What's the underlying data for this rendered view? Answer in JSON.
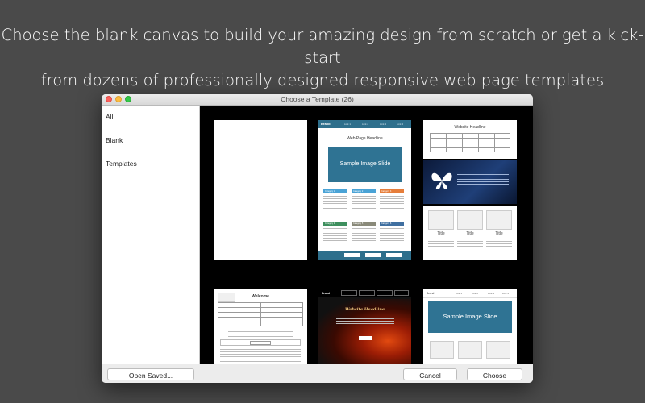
{
  "headline": {
    "line1": "Choose the blank canvas to build your amazing design from scratch or get a kick-start",
    "line2": "from dozens of professionally designed responsive web page templates"
  },
  "window": {
    "title": "Choose a Template (26)"
  },
  "sidebar": {
    "items": [
      {
        "label": "All"
      },
      {
        "label": "Blank"
      },
      {
        "label": "Templates"
      }
    ]
  },
  "thumbnails": {
    "t2": {
      "headline": "Web Page Headline",
      "slide": "Sample Image Slide"
    },
    "t3": {
      "headline": "Website Headline",
      "title_a": "Title",
      "title_b": "Title",
      "title_c": "Title"
    },
    "t4": {
      "headline": "Welcome"
    },
    "t5": {
      "headline": "Website Headline"
    },
    "t6": {
      "slide": "Sample Image Slide"
    }
  },
  "buttons": {
    "open_saved": "Open Saved...",
    "cancel": "Cancel",
    "choose": "Choose"
  }
}
